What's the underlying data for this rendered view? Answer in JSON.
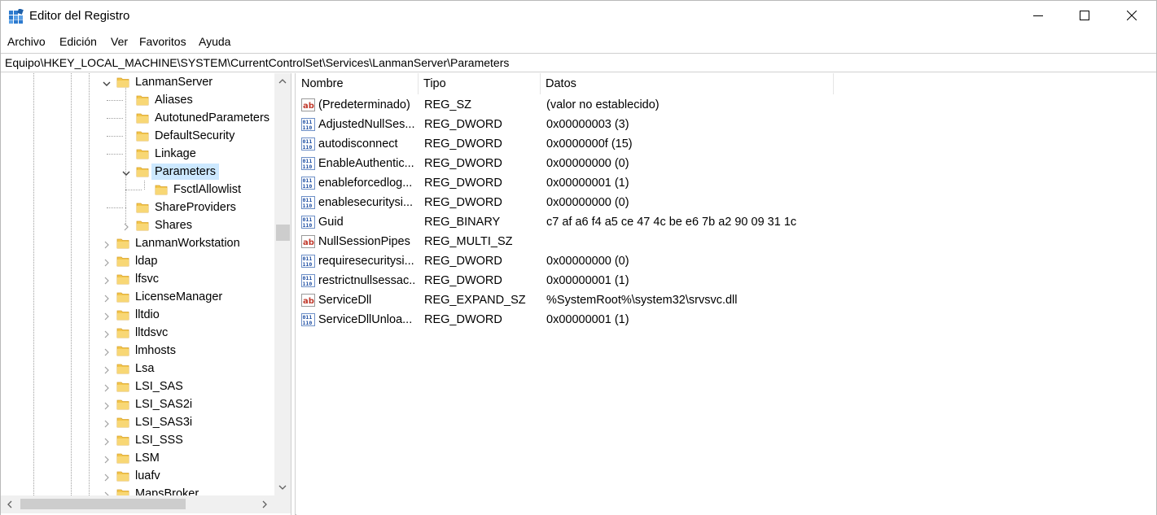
{
  "window": {
    "title": "Editor del Registro",
    "icon": "regedit-icon",
    "minimize_icon": "minimize-icon",
    "maximize_icon": "maximize-icon",
    "close_icon": "close-icon"
  },
  "menu": {
    "items": [
      "Archivo",
      "Edición",
      "Ver",
      "Favoritos",
      "Ayuda"
    ]
  },
  "address": {
    "path": "Equipo\\HKEY_LOCAL_MACHINE\\SYSTEM\\CurrentControlSet\\Services\\LanmanServer\\Parameters"
  },
  "tree": {
    "nodes": [
      {
        "label": "LanmanServer",
        "level": 0,
        "expander": "expanded"
      },
      {
        "label": "Aliases",
        "level": 1,
        "expander": "none"
      },
      {
        "label": "AutotunedParameters",
        "level": 1,
        "expander": "none"
      },
      {
        "label": "DefaultSecurity",
        "level": 1,
        "expander": "none"
      },
      {
        "label": "Linkage",
        "level": 1,
        "expander": "none"
      },
      {
        "label": "Parameters",
        "level": 1,
        "expander": "expanded",
        "selected": true
      },
      {
        "label": "FsctlAllowlist",
        "level": 2,
        "expander": "none"
      },
      {
        "label": "ShareProviders",
        "level": 1,
        "expander": "none"
      },
      {
        "label": "Shares",
        "level": 1,
        "expander": "collapsed"
      },
      {
        "label": "LanmanWorkstation",
        "level": 0,
        "expander": "collapsed"
      },
      {
        "label": "ldap",
        "level": 0,
        "expander": "collapsed"
      },
      {
        "label": "lfsvc",
        "level": 0,
        "expander": "collapsed"
      },
      {
        "label": "LicenseManager",
        "level": 0,
        "expander": "collapsed"
      },
      {
        "label": "lltdio",
        "level": 0,
        "expander": "collapsed"
      },
      {
        "label": "lltdsvc",
        "level": 0,
        "expander": "collapsed"
      },
      {
        "label": "lmhosts",
        "level": 0,
        "expander": "collapsed"
      },
      {
        "label": "Lsa",
        "level": 0,
        "expander": "collapsed"
      },
      {
        "label": "LSI_SAS",
        "level": 0,
        "expander": "collapsed"
      },
      {
        "label": "LSI_SAS2i",
        "level": 0,
        "expander": "collapsed"
      },
      {
        "label": "LSI_SAS3i",
        "level": 0,
        "expander": "collapsed"
      },
      {
        "label": "LSI_SSS",
        "level": 0,
        "expander": "collapsed"
      },
      {
        "label": "LSM",
        "level": 0,
        "expander": "collapsed"
      },
      {
        "label": "luafv",
        "level": 0,
        "expander": "collapsed"
      },
      {
        "label": "MapsBroker",
        "level": 0,
        "expander": "collapsed"
      }
    ]
  },
  "list": {
    "columns": [
      "Nombre",
      "Tipo",
      "Datos"
    ],
    "rows": [
      {
        "icon": "string-value-icon",
        "name": "(Predeterminado)",
        "type": "REG_SZ",
        "data": "(valor no establecido)"
      },
      {
        "icon": "binary-value-icon",
        "name": "AdjustedNullSes...",
        "type": "REG_DWORD",
        "data": "0x00000003 (3)"
      },
      {
        "icon": "binary-value-icon",
        "name": "autodisconnect",
        "type": "REG_DWORD",
        "data": "0x0000000f (15)"
      },
      {
        "icon": "binary-value-icon",
        "name": "EnableAuthentic...",
        "type": "REG_DWORD",
        "data": "0x00000000 (0)"
      },
      {
        "icon": "binary-value-icon",
        "name": "enableforcedlog...",
        "type": "REG_DWORD",
        "data": "0x00000001 (1)"
      },
      {
        "icon": "binary-value-icon",
        "name": "enablesecuritysi...",
        "type": "REG_DWORD",
        "data": "0x00000000 (0)"
      },
      {
        "icon": "binary-value-icon",
        "name": "Guid",
        "type": "REG_BINARY",
        "data": "c7 af a6 f4 a5 ce 47 4c be e6 7b a2 90 09 31 1c"
      },
      {
        "icon": "string-value-icon",
        "name": "NullSessionPipes",
        "type": "REG_MULTI_SZ",
        "data": ""
      },
      {
        "icon": "binary-value-icon",
        "name": "requiresecuritysi...",
        "type": "REG_DWORD",
        "data": "0x00000000 (0)"
      },
      {
        "icon": "binary-value-icon",
        "name": "restrictnullsessac...",
        "type": "REG_DWORD",
        "data": "0x00000001 (1)"
      },
      {
        "icon": "string-value-icon",
        "name": "ServiceDll",
        "type": "REG_EXPAND_SZ",
        "data": "%SystemRoot%\\system32\\srvsvc.dll"
      },
      {
        "icon": "binary-value-icon",
        "name": "ServiceDllUnloa...",
        "type": "REG_DWORD",
        "data": "0x00000001 (1)"
      }
    ]
  },
  "colors": {
    "selection": "#cce8ff",
    "folder": "#f3c64b",
    "accent": "#0078d7"
  }
}
